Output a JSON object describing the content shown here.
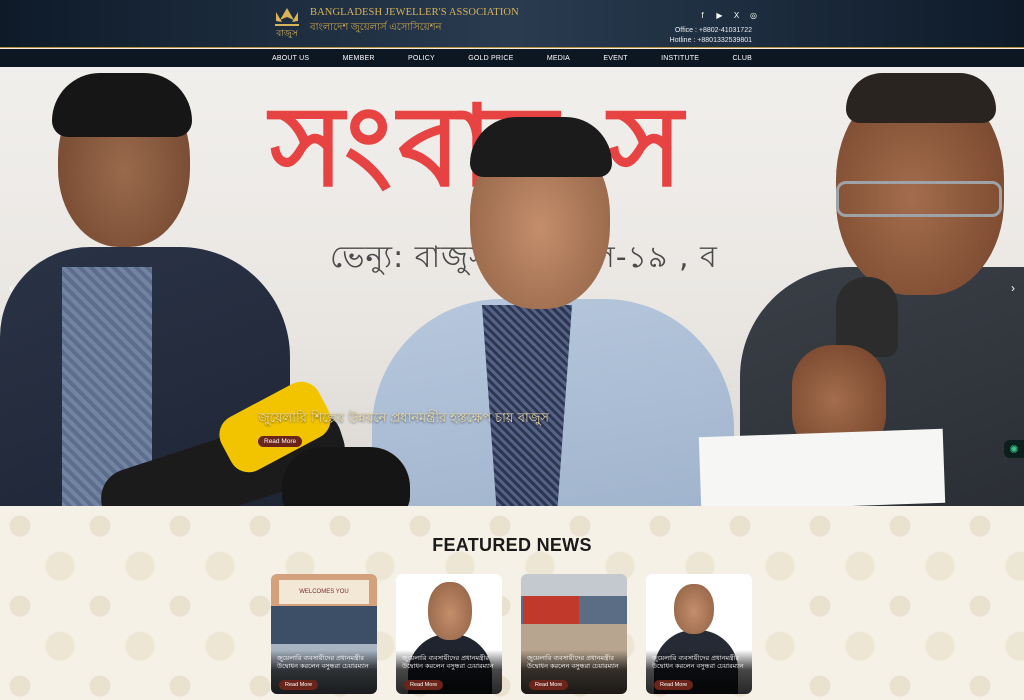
{
  "header": {
    "logo_bn_short": "বাজুস",
    "logo_en": "BANGLADESH JEWELLER'S ASSOCIATION",
    "logo_bn": "বাংলাদেশ জুয়েলার্স এসোসিয়েশন",
    "social": [
      {
        "icon": "facebook-icon",
        "glyph": "f"
      },
      {
        "icon": "youtube-icon",
        "glyph": "▶"
      },
      {
        "icon": "x-icon",
        "glyph": "X"
      },
      {
        "icon": "instagram-icon",
        "glyph": "◎"
      }
    ],
    "office": "Office : +8802-41031722",
    "hotline": "Hotline : +8801332539801"
  },
  "nav": {
    "items": [
      {
        "label": "ABOUT US"
      },
      {
        "label": "MEMBER"
      },
      {
        "label": "POLICY"
      },
      {
        "label": "GOLD PRICE"
      },
      {
        "label": "MEDIA"
      },
      {
        "label": "EVENT"
      },
      {
        "label": "INSTITUTE"
      },
      {
        "label": "CLUB"
      }
    ]
  },
  "hero": {
    "banner_title": "সংবাদ স",
    "banner_venue": "ভেন্যু: বাজুস , লেভেল-১৯ , ব",
    "caption": "জুয়েলারি শিল্পের উন্নয়নে প্রধানমন্ত্রীর হস্তক্ষেপ চায় বাজুস",
    "read_more": "Read More",
    "prev_glyph": "‹",
    "next_glyph": "›",
    "active_slide": 3,
    "slide_count": 3
  },
  "featured": {
    "title": "FEATURED NEWS",
    "cards": [
      {
        "caption": "জুয়েলারি ব্যবসায়ীদের প্রধানমন্ত্রীর উদ্বোধন করলেন বসুন্ধরা চেয়ারম্যান",
        "button": "Read More",
        "sign": "WELCOMES YOU"
      },
      {
        "caption": "জুয়েলারি ব্যবসায়ীদের প্রধানমন্ত্রীর উদ্বোধন করলেন বসুন্ধরা চেয়ারম্যান",
        "button": "Read More"
      },
      {
        "caption": "জুয়েলারি ব্যবসায়ীদের প্রধানমন্ত্রীর উদ্বোধন করলেন বসুন্ধরা চেয়ারম্যান",
        "button": "Read More"
      },
      {
        "caption": "জুয়েলারি ব্যবসায়ীদের প্রধানমন্ত্রীর উদ্বোধন করলেন বসুন্ধরা চেয়ারম্যান",
        "button": "Read More"
      }
    ]
  },
  "colors": {
    "header_bg": "#1c2b3d",
    "gold": "#d7b45a",
    "read_more_bg": "#6a2419",
    "banner_red": "#e63a3a"
  }
}
